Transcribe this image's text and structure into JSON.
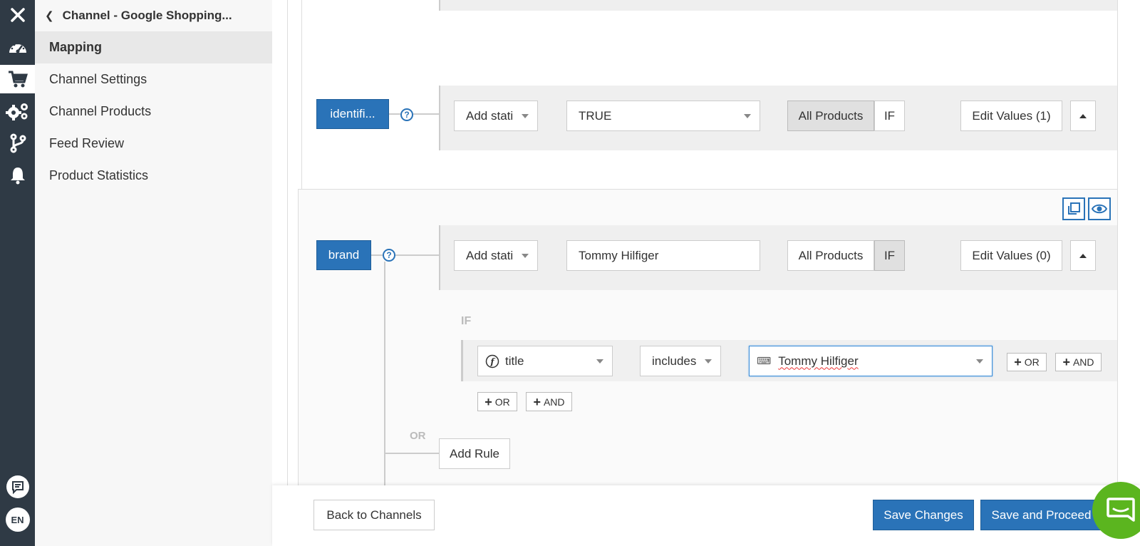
{
  "sidebar": {
    "back_title": "Channel - Google Shopping...",
    "items": [
      {
        "label": "Mapping"
      },
      {
        "label": "Channel Settings"
      },
      {
        "label": "Channel Products"
      },
      {
        "label": "Feed Review"
      },
      {
        "label": "Product Statistics"
      }
    ]
  },
  "rail": {
    "icons": [
      "close-icon",
      "dashboard-icon",
      "cart-icon",
      "settings-icon",
      "branch-icon",
      "bell-icon",
      "feedback-icon",
      "language-icon"
    ],
    "language": "EN"
  },
  "rules": [
    {
      "field": "identifi...",
      "source_select": "Add stati",
      "value": "TRUE",
      "scope_all": "All Products",
      "scope_if": "IF",
      "active_scope": "all",
      "edit_values": "Edit Values (1)"
    },
    {
      "field": "brand",
      "source_select": "Add stati",
      "value": "Tommy Hilfiger",
      "scope_all": "All Products",
      "scope_if": "IF",
      "active_scope": "if",
      "edit_values": "Edit Values (0)",
      "condition": {
        "label": "IF",
        "attribute": "title",
        "operator": "includes",
        "input_value": "Tommy Hilfiger"
      },
      "or_label": "+ OR",
      "and_label": "+ AND",
      "or_text": "OR",
      "and_text": "AND",
      "or_divider": "OR",
      "add_rule": "Add Rule"
    }
  ],
  "footer": {
    "back": "Back to Channels",
    "save": "Save Changes",
    "save_proceed": "Save and Proceed"
  },
  "colors": {
    "accent": "#2a73b8",
    "rail": "#2f3a45",
    "chat": "#5bb51f"
  }
}
